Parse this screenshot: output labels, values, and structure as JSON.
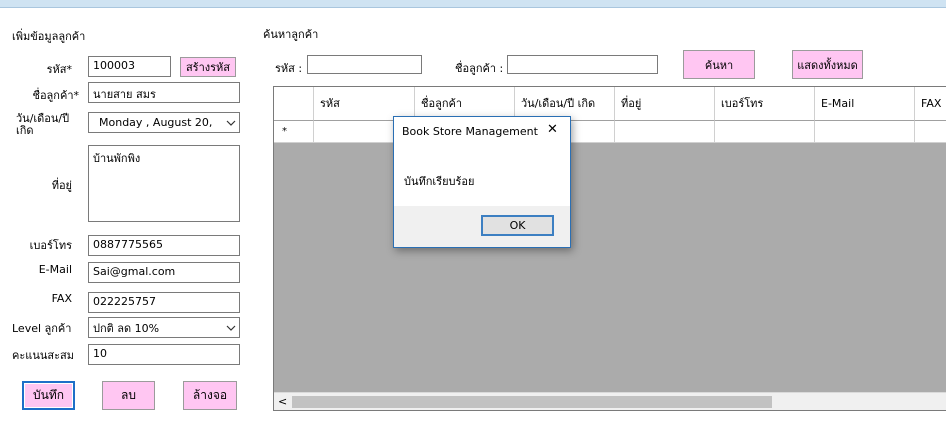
{
  "customer_form": {
    "title": "เพิ่มข้อมูลลูกค้า",
    "code_label": "รหัส*",
    "code_value": "100003",
    "generate_code_label": "สร้างรหัส",
    "name_label": "ชื่อลูกค้า*",
    "name_value": "นายสาย สมร",
    "dob_label": "วัน/เดือน/ปี เกิด",
    "dob_value": "Monday    ,    August    20,",
    "address_label": "ที่อยู่",
    "address_value": "บ้านพักพิง",
    "phone_label": "เบอร์โทร",
    "phone_value": "0887775565",
    "email_label": "E-Mail",
    "email_value": "Sai@gmal.com",
    "fax_label": "FAX",
    "fax_value": "022225757",
    "level_label": "Level ลูกค้า",
    "level_value": "ปกติ ลด 10%",
    "points_label": "คะแนนสะสม",
    "points_value": "10",
    "save_label": "บันทึก",
    "delete_label": "ลบ",
    "clear_label": "ล้างจอ"
  },
  "search": {
    "title": "ค้นหาลูกค้า",
    "code_label": "รหัส :",
    "code_value": "",
    "name_label": "ชื่อลูกค้า :",
    "name_value": "",
    "search_label": "ค้นหา",
    "show_all_label": "แสดงทั้งหมด"
  },
  "grid": {
    "columns": [
      "รหัส",
      "ชื่อลูกค้า",
      "วัน/เดือน/ปี เกิด",
      "ที่อยู่",
      "เบอร์โทร",
      "E-Mail",
      "FAX"
    ],
    "new_row_marker": "*",
    "scroll_left_glyph": "<"
  },
  "dialog": {
    "title": "Book Store Management",
    "close_glyph": "✕",
    "message": "บันทึกเรียบร้อย",
    "ok_label": "OK"
  },
  "icons": {
    "dropdown": "chevron-down-icon",
    "close": "close-icon",
    "scroll_left": "chevron-left-icon"
  },
  "colors": {
    "pink_button": "#ffc6f2",
    "grid_background": "#ababab",
    "dialog_border": "#2a6fb4",
    "selected_button_border": "#1e6fc8"
  }
}
